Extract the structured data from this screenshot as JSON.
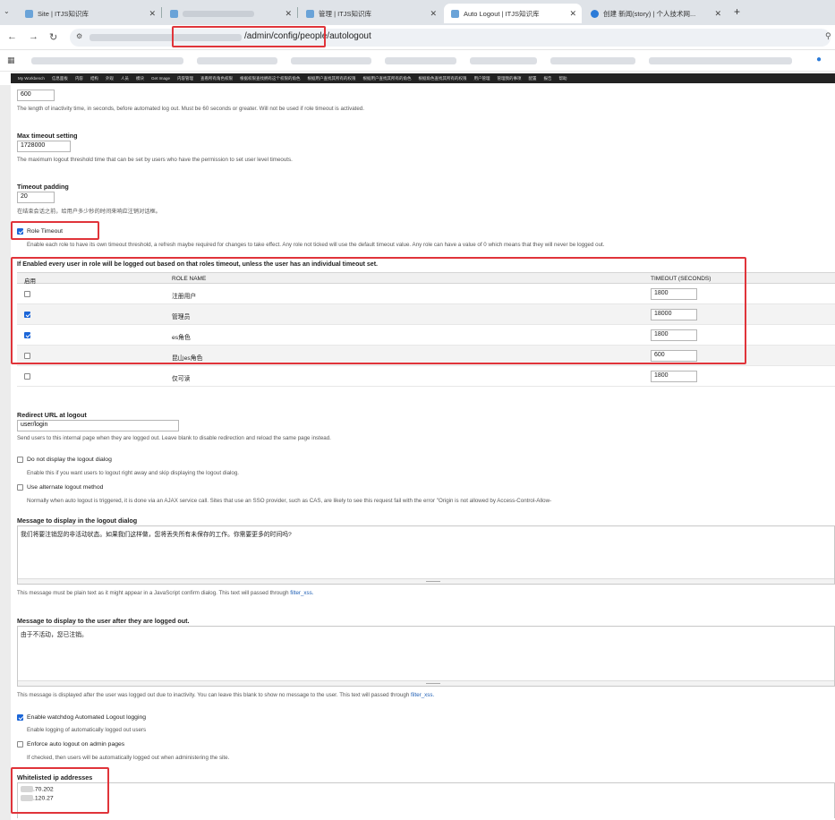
{
  "browser": {
    "tabs": [
      {
        "title": "Site | ITJS知识库"
      },
      {
        "title": ""
      },
      {
        "title": "管理 | ITJS知识库"
      },
      {
        "title": "Auto Logout | ITJS知识库"
      },
      {
        "title": "创建 新闻(story) | 个人技术网..."
      }
    ],
    "url": "/admin/config/people/autologout"
  },
  "adminbar": [
    "My Workbench",
    "信息面板",
    "内容",
    "结构",
    "外观",
    "人员",
    "模块",
    "Get Image",
    "内容管理",
    "查看所有角色权限",
    "根据权限查找拥有这个权限的角色",
    "根据用户查找其所有的权限",
    "根据用户查找其所有的角色",
    "根据角色查找其所有的权限",
    "用户管理",
    "管理我的事项",
    "配置",
    "报告",
    "帮助"
  ],
  "timeout": {
    "value": "600",
    "desc": "The length of inactivity time, in seconds, before automated log out. Must be 60 seconds or greater. Will not be used if role timeout is activated."
  },
  "max_timeout": {
    "label": "Max timeout setting",
    "value": "1728000",
    "desc": "The maximum logout threshold time that can be set by users who have the permission to set user level timeouts."
  },
  "padding": {
    "label": "Timeout padding",
    "value": "20",
    "desc": "在结束会话之前，给用户多少秒的时间来响应注销对话框。"
  },
  "role_timeout": {
    "label": "Role Timeout",
    "desc": "Enable each role to have its own timeout threshold, a refresh maybe required for changes to take effect. Any role not ticked will use the default timeout value. Any role can have a value of 0 which means that they will never be logged out."
  },
  "role_table": {
    "title": "If Enabled every user in role will be logged out based on that roles timeout, unless the user has an individual timeout set.",
    "headers": {
      "enabled": "启用",
      "role": "ROLE NAME",
      "timeout": "TIMEOUT (SECONDS)"
    },
    "rows": [
      {
        "name": "注册用户",
        "checked": false,
        "timeout": "1800"
      },
      {
        "name": "管理员",
        "checked": true,
        "timeout": "18000"
      },
      {
        "name": "es角色",
        "checked": true,
        "timeout": "1800"
      },
      {
        "name": "昆山es角色",
        "checked": false,
        "timeout": "600"
      },
      {
        "name": "仅可读",
        "checked": false,
        "timeout": "1800"
      }
    ]
  },
  "redirect": {
    "label": "Redirect URL at logout",
    "value": "user/login",
    "desc": "Send users to this internal page when they are logged out. Leave blank to disable redirection and reload the same page instead."
  },
  "no_dialog": {
    "label": "Do not display the logout dialog",
    "desc": "Enable this if you want users to logout right away and skip displaying the logout dialog."
  },
  "alt_logout": {
    "label": "Use alternate logout method",
    "desc": "Normally when auto logout is triggered, it is done via an AJAX service call. Sites that use an SSO provider, such as CAS, are likely to see this request fail with the error \"Origin is not allowed by Access-Control-Allow-"
  },
  "dialog_msg": {
    "label": "Message to display in the logout dialog",
    "value": "我们将要注销您的非活动状态。如果我们这样做，您将丢失所有未保存的工作。你需要更多的时间吗?",
    "desc": "This message must be plain text as it might appear in a JavaScript confirm dialog. This text will passed through",
    "link": "filter_xss."
  },
  "after_msg": {
    "label": "Message to display to the user after they are logged out.",
    "value": "由于不活动，您已注销。",
    "desc": "This message is displayed after the user was logged out due to inactivity. You can leave this blank to show no message to the user. This text will passed through",
    "link": "filter_xss."
  },
  "watchdog": {
    "label": "Enable watchdog Automated Logout logging",
    "desc": "Enable logging of automatically logged out users"
  },
  "enforce_admin": {
    "label": "Enforce auto logout on admin pages",
    "desc": "If checked, then users will be automatically logged out when administering the site."
  },
  "whitelist": {
    "label": "Whitelisted ip addresses",
    "ips": [
      ".70.202",
      ".120.27"
    ]
  }
}
